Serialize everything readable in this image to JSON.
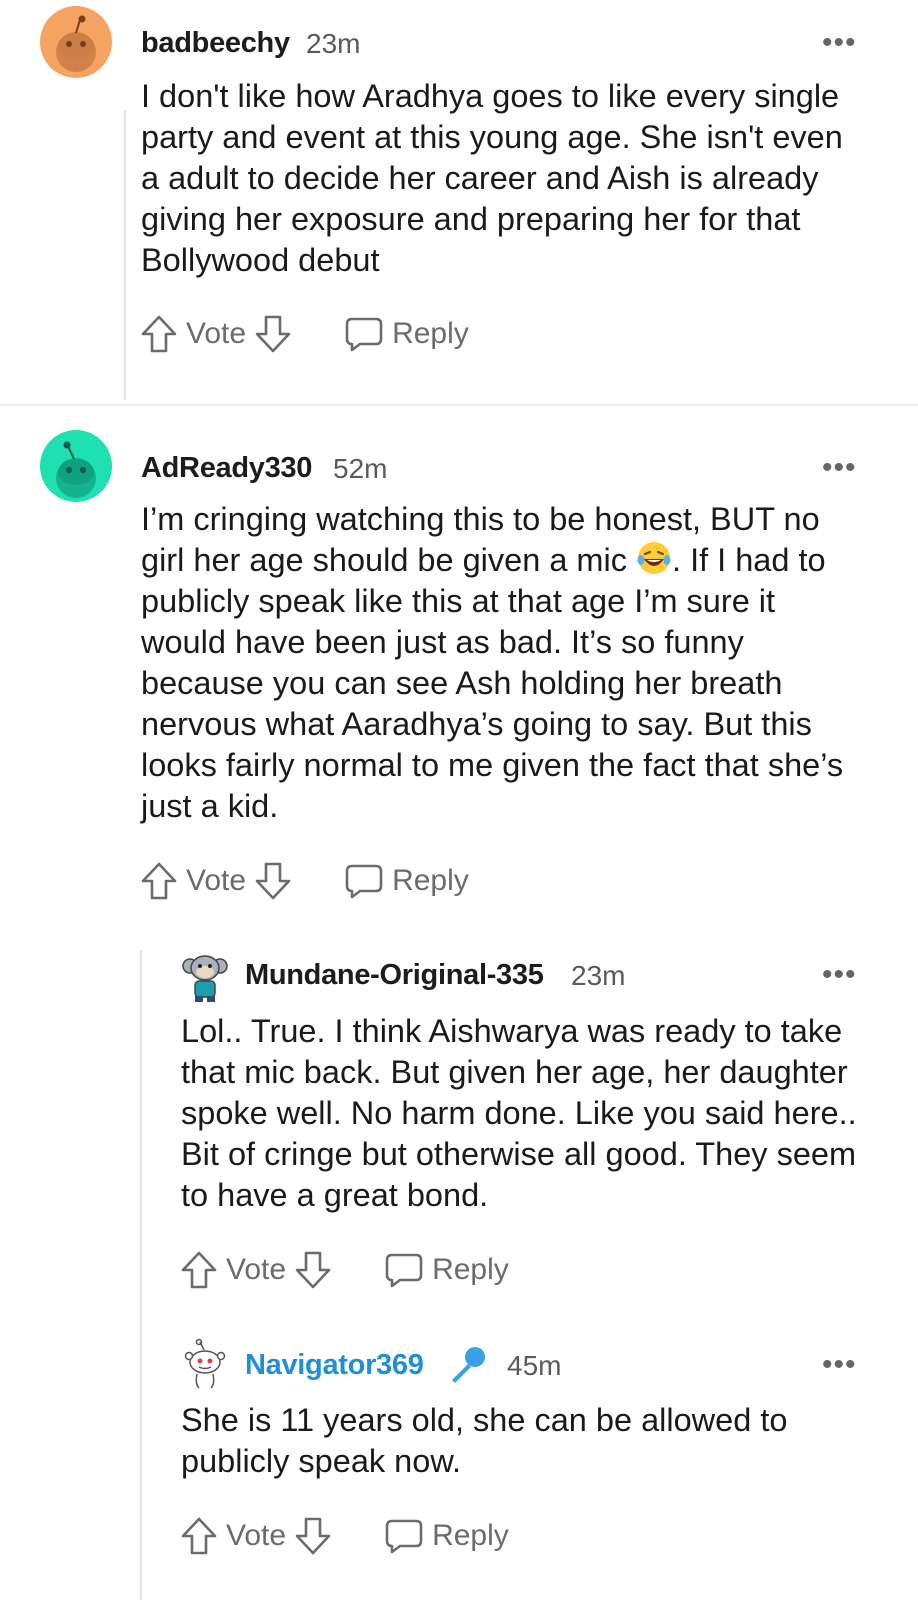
{
  "comments": [
    {
      "username": "badbeechy",
      "time": "23m",
      "text": "I don't like how Aradhya goes to like every single party and event at this young age. She isn't even a adult to decide her career and Aish is already giving her exposure and preparing her for that Bollywood debut",
      "vote_label": "Vote",
      "reply_label": "Reply",
      "avatar_color": "#f4a460"
    },
    {
      "username": "AdReady330",
      "time": "52m",
      "text_before_emoji": "I’m cringing watching this to be honest, BUT no girl her age should be given a mic ",
      "text_after_emoji": ". If I had to publicly speak like this at that age I’m sure it would have been just as bad. It’s so funny because you can see Ash holding her breath nervous what Aaradhya’s going to say. But this looks fairly normal to me given the fact that she’s just a kid.",
      "vote_label": "Vote",
      "reply_label": "Reply",
      "avatar_color": "#1ee0b0"
    },
    {
      "username": "Mundane-Original-335",
      "time": "23m",
      "text": "Lol.. True. I think Aishwarya was ready to take that mic back. But given her age, her daughter spoke well. No harm done. Like you said here.. Bit of cringe but otherwise all good. They seem to have a great bond.",
      "vote_label": "Vote",
      "reply_label": "Reply"
    },
    {
      "username": "Navigator369",
      "time": "45m",
      "text": "She is 11 years old, she can be allowed to publicly speak now.",
      "vote_label": "Vote",
      "reply_label": "Reply",
      "username_color": "#1f8fd6"
    }
  ],
  "more_label": "•••"
}
